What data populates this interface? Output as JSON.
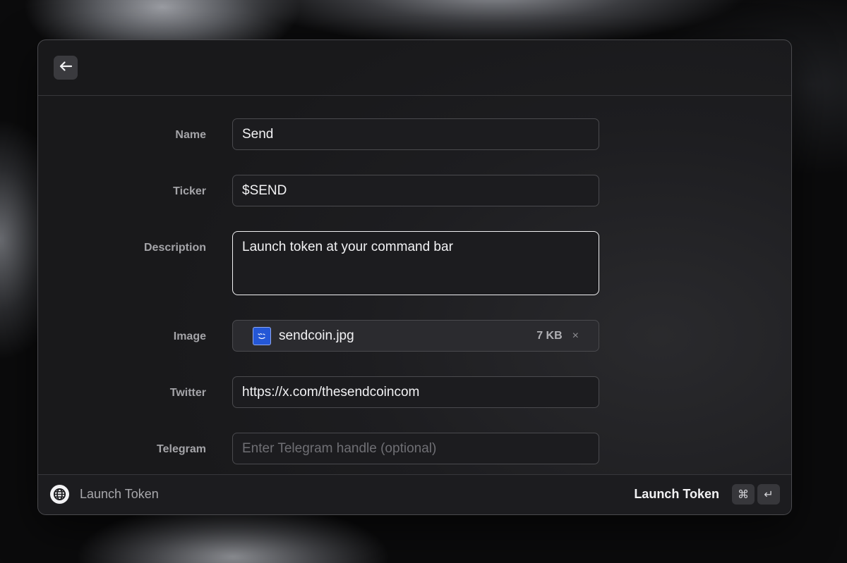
{
  "header": {
    "back_icon": "arrow-left-icon"
  },
  "form": {
    "name": {
      "label": "Name",
      "value": "Send"
    },
    "ticker": {
      "label": "Ticker",
      "value": "$SEND"
    },
    "description": {
      "label": "Description",
      "value": "Launch token at your command bar"
    },
    "image": {
      "label": "Image",
      "file_name": "sendcoin.jpg",
      "file_size": "7 KB",
      "remove_glyph": "×",
      "thumb_color": "#2457d6"
    },
    "twitter": {
      "label": "Twitter",
      "value": "https://x.com/thesendcoincom"
    },
    "telegram": {
      "label": "Telegram",
      "value": "",
      "placeholder": "Enter Telegram handle (optional)"
    }
  },
  "footer": {
    "icon": "globe-icon",
    "title": "Launch Token",
    "primary_action": "Launch Token",
    "shortcut": {
      "modifier": "⌘",
      "key": "↵"
    }
  }
}
